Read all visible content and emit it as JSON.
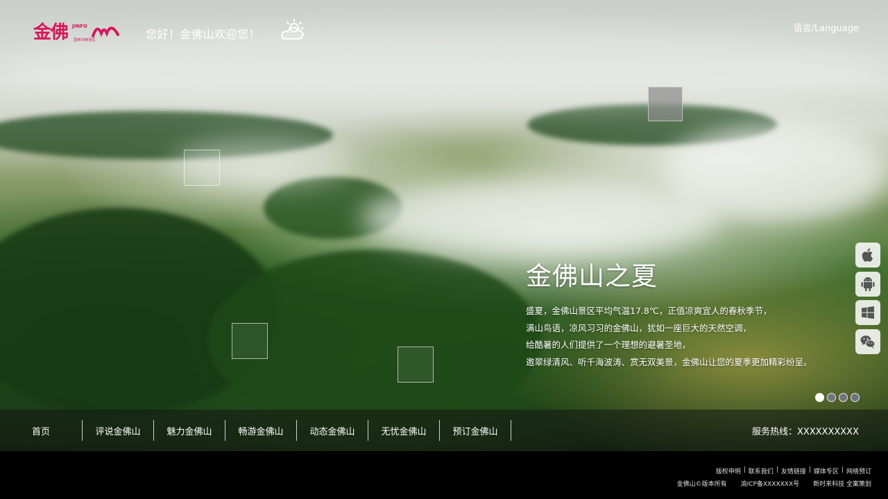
{
  "header": {
    "logo_text": "金佛",
    "logo_sub": "JINFO",
    "logo_tag": "国家5A级景区",
    "greeting": "您好！金佛山欢迎您！",
    "weather_icon": "partly-cloudy-icon",
    "language": "语言/Language"
  },
  "feature": {
    "title": "金佛山之夏",
    "lines": [
      "盛夏，金佛山景区平均气温17.8℃，正值凉爽宜人的春秋季节，",
      "满山鸟语，凉风习习的金佛山，犹如一座巨大的天然空调，",
      "给酷暑的人们提供了一个理想的避暑圣地，",
      "邀翠绿清风、听千海波涛、赏无双美景，金佛山让您的夏季更加精彩纷呈。"
    ]
  },
  "apps": [
    {
      "icon": "apple-icon"
    },
    {
      "icon": "android-icon"
    },
    {
      "icon": "windows-icon"
    },
    {
      "icon": "wechat-icon"
    }
  ],
  "slider": {
    "count": 4,
    "active": 0
  },
  "nav": {
    "items": [
      "首页",
      "评说金佛山",
      "魅力金佛山",
      "畅游金佛山",
      "动态金佛山",
      "无忧金佛山",
      "预订金佛山"
    ],
    "hotline": "服务热线：XXXXXXXXXX"
  },
  "footer": {
    "links": [
      "版权申明",
      "联系我们",
      "友情链接",
      "媒体专区",
      "网络预订"
    ],
    "copyright": "金佛山©版本所有",
    "icp": "渝ICP备XXXXXXX号",
    "credit": "新时来科技 全案策划"
  },
  "colors": {
    "brand": "#d8155c",
    "nav_bg": "#14180f",
    "footer_bg": "#000000"
  }
}
